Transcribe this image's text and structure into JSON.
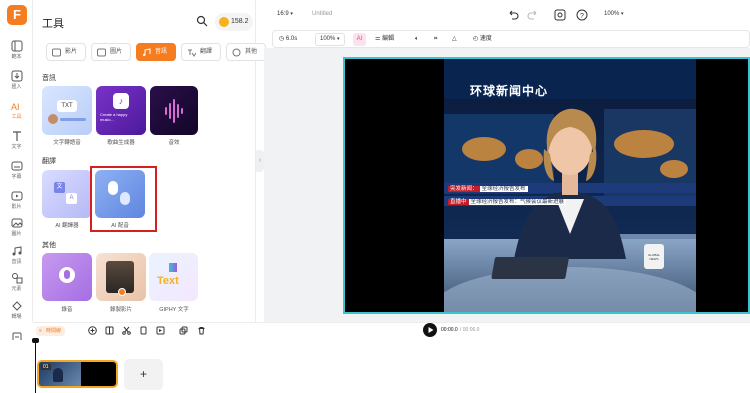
{
  "rail": {
    "logo": "F",
    "items": [
      {
        "label": "範本",
        "icon": "template-icon"
      },
      {
        "label": "匯入",
        "icon": "import-icon"
      },
      {
        "label": "工具",
        "icon": "ai-tools-icon"
      },
      {
        "label": "文字",
        "icon": "text-icon"
      },
      {
        "label": "字幕",
        "icon": "subtitles-icon"
      },
      {
        "label": "影片",
        "icon": "video-icon"
      },
      {
        "label": "圖片",
        "icon": "image-icon"
      },
      {
        "label": "音訊",
        "icon": "audio-icon"
      },
      {
        "label": "元素",
        "icon": "elements-icon"
      },
      {
        "label": "轉場",
        "icon": "transition-icon"
      },
      {
        "label": "品牌",
        "icon": "brand-icon"
      }
    ],
    "active_index": 2
  },
  "panel": {
    "title": "工具",
    "credits": "158.2",
    "tabs": [
      "影片",
      "圖片",
      "音訊",
      "翻譯",
      "其他"
    ],
    "active_tab": 2,
    "sections": [
      {
        "label": "音訊",
        "cards": [
          {
            "caption": "文字轉語音",
            "thumb_text": "TXT"
          },
          {
            "caption": "歌曲生成器",
            "thumb_text": "Create a happy music..."
          },
          {
            "caption": "音效",
            "thumb_text": ""
          }
        ]
      },
      {
        "label": "翻譯",
        "cards": [
          {
            "caption": "AI 翻譯器",
            "thumb_text": ""
          },
          {
            "caption": "AI 配音",
            "thumb_text": ""
          }
        ]
      },
      {
        "label": "其他",
        "cards": [
          {
            "caption": "錄音",
            "thumb_text": ""
          },
          {
            "caption": "錄製影片",
            "thumb_text": ""
          },
          {
            "caption": "GIPHY 文字",
            "thumb_text": "Text"
          }
        ]
      }
    ]
  },
  "topbar": {
    "ratio": "16:9",
    "project_name": "Untitled",
    "zoom": "100%"
  },
  "toolbar2": {
    "duration": "6.0s",
    "scale": "100%",
    "edit": "編輯",
    "speed": "速度"
  },
  "canvas": {
    "banner_title": "环球新闻中心",
    "ticker1_tag": "突发新闻：",
    "ticker1_text": "全球经济报告发布",
    "ticker2_tag": "直播中",
    "ticker2_text": "全球经济报告发布：气候会议最新进展",
    "mug_text": "GLOBAL NEWS"
  },
  "timeline": {
    "label": "時間線",
    "current_time": "00:00.0",
    "total_time": "/ 00:06.0",
    "clip_number": "01",
    "add_label": "+"
  },
  "colors": {
    "accent": "#f57c1f",
    "highlight": "#d62020",
    "stage_border": "#3cc3d0"
  }
}
